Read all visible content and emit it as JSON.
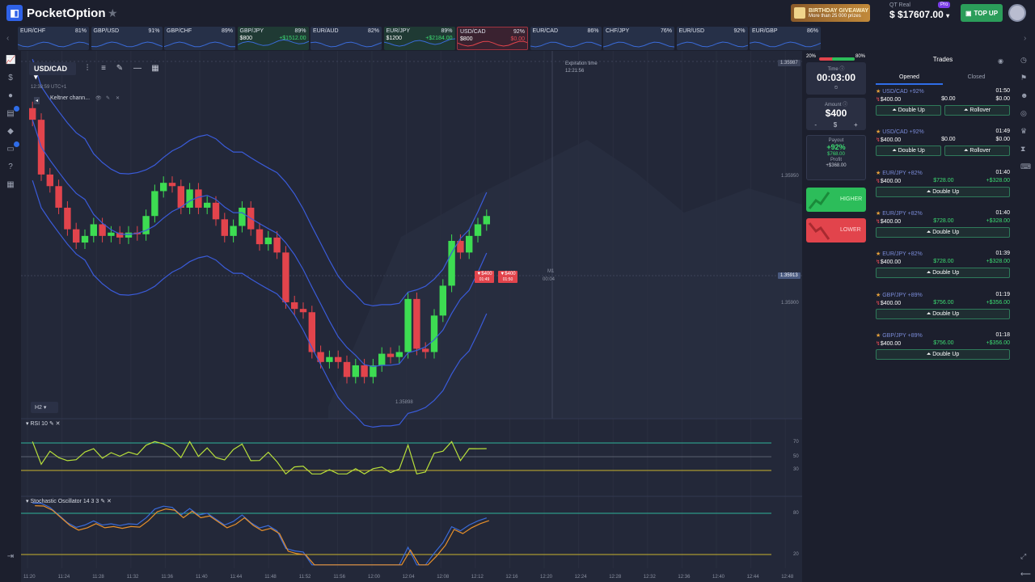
{
  "header": {
    "brand": "PocketOption",
    "promo_title": "BIRTHDAY GIVEAWAY",
    "promo_sub": "More than 25 000 prizes",
    "account_label": "QT Real",
    "balance": "$17607.00",
    "pro_badge": "Pro",
    "topup_label": "TOP UP"
  },
  "tickers": [
    {
      "name": "EUR/CHF",
      "pct": "81%",
      "amount": "",
      "profit": "",
      "state": "normal"
    },
    {
      "name": "GBP/USD",
      "pct": "91%",
      "amount": "",
      "profit": "",
      "state": "normal"
    },
    {
      "name": "GBP/CHF",
      "pct": "89%",
      "amount": "",
      "profit": "",
      "state": "normal"
    },
    {
      "name": "GBP/JPY",
      "pct": "89%",
      "amount": "$800",
      "profit": "+$1512.00",
      "state": "green"
    },
    {
      "name": "EUR/AUD",
      "pct": "82%",
      "amount": "",
      "profit": "",
      "state": "normal"
    },
    {
      "name": "EUR/JPY",
      "pct": "89%",
      "amount": "$1200",
      "profit": "+$2184.00",
      "state": "green"
    },
    {
      "name": "USD/CAD",
      "pct": "92%",
      "amount": "$800",
      "profit": "$0.00",
      "state": "red"
    },
    {
      "name": "EUR/CAD",
      "pct": "86%",
      "amount": "",
      "profit": "",
      "state": "normal"
    },
    {
      "name": "CHF/JPY",
      "pct": "76%",
      "amount": "",
      "profit": "",
      "state": "normal"
    },
    {
      "name": "EUR/USD",
      "pct": "92%",
      "amount": "",
      "profit": "",
      "state": "normal"
    },
    {
      "name": "EUR/GBP",
      "pct": "86%",
      "amount": "",
      "profit": "",
      "state": "normal"
    }
  ],
  "chart": {
    "asset": "USD/CAD",
    "time_label": "12:38:59 UTC+1",
    "indicator": "Keltner chann...",
    "expiration_label": "Expiration time",
    "expiration_time": "12:21:56",
    "timeframe": "H2",
    "price_top": "1.35987",
    "price_1": "1.35950",
    "price_current": "1.35913",
    "price_2": "1.35900",
    "price_low": "1.35898",
    "m1": "M1",
    "m1_sub": "00:04",
    "markers": [
      {
        "label": "▼$400",
        "sub": "01:49"
      },
      {
        "label": "▼$400",
        "sub": "01:50"
      }
    ],
    "rsi_label": "RSI 10",
    "rsi_levels": [
      "70",
      "50",
      "30"
    ],
    "stoch_label": "Stochastic Oscillator 14 3 3",
    "stoch_levels": [
      "80",
      "20"
    ],
    "x_labels": [
      "11:20",
      "11:24",
      "11:28",
      "11:32",
      "11:36",
      "11:40",
      "11:44",
      "11:48",
      "11:52",
      "11:56",
      "12:00",
      "12:04",
      "12:08",
      "12:12",
      "12:16",
      "12:20",
      "12:24",
      "12:28",
      "12:32",
      "12:36",
      "12:40",
      "12:44",
      "12:48"
    ]
  },
  "order": {
    "bar_left": "20%",
    "bar_right": "80%",
    "time_caption": "Time",
    "time_value": "00:03:00",
    "amount_caption": "Amount",
    "amount_value": "$400",
    "minus": "-",
    "currency": "$",
    "plus": "+",
    "payout_caption": "Payout",
    "payout_pct": "+92%",
    "payout_value": "$768.00",
    "profit_caption": "Profit",
    "profit_value": "+$368.00",
    "higher_label": "HIGHER",
    "lower_label": "LOWER"
  },
  "trades_panel": {
    "title": "Trades",
    "tabs": [
      "Opened",
      "Closed"
    ],
    "items": [
      {
        "pair": "USD/CAD +92%",
        "time": "01:50",
        "amount": "$400.00",
        "mid": "$0.00",
        "result": "$0.00",
        "buttons": [
          "Double Up",
          "Rollover"
        ]
      },
      {
        "pair": "USD/CAD +92%",
        "time": "01:49",
        "amount": "$400.00",
        "mid": "$0.00",
        "result": "$0.00",
        "buttons": [
          "Double Up",
          "Rollover"
        ]
      },
      {
        "pair": "EUR/JPY +82%",
        "time": "01:40",
        "amount": "$400.00",
        "mid": "$728.00",
        "result": "+$328.00",
        "buttons": [
          "Double Up"
        ]
      },
      {
        "pair": "EUR/JPY +82%",
        "time": "01:40",
        "amount": "$400.00",
        "mid": "$728.00",
        "result": "+$328.00",
        "buttons": [
          "Double Up"
        ]
      },
      {
        "pair": "EUR/JPY +82%",
        "time": "01:39",
        "amount": "$400.00",
        "mid": "$728.00",
        "result": "+$328.00",
        "buttons": [
          "Double Up"
        ]
      },
      {
        "pair": "GBP/JPY +89%",
        "time": "01:19",
        "amount": "$400.00",
        "mid": "$756.00",
        "result": "+$356.00",
        "buttons": [
          "Double Up"
        ]
      },
      {
        "pair": "GBP/JPY +89%",
        "time": "01:18",
        "amount": "$400.00",
        "mid": "$756.00",
        "result": "+$356.00",
        "buttons": [
          "Double Up"
        ]
      }
    ]
  },
  "colors": {
    "up": "#3ddc52",
    "down": "#e2444c",
    "keltner": "#3a5bd9",
    "rsi": "#b8e03a",
    "stoch_k": "#3a6bd9",
    "stoch_d": "#e8902a",
    "level": "#2fb39a"
  },
  "candles": [
    {
      "o": 1.35975,
      "c": 1.35968
    },
    {
      "o": 1.35968,
      "c": 1.35935
    },
    {
      "o": 1.35935,
      "c": 1.35928
    },
    {
      "o": 1.35928,
      "c": 1.35915
    },
    {
      "o": 1.35915,
      "c": 1.35902
    },
    {
      "o": 1.35902,
      "c": 1.35894
    },
    {
      "o": 1.35894,
      "c": 1.35898
    },
    {
      "o": 1.35898,
      "c": 1.35905
    },
    {
      "o": 1.35905,
      "c": 1.35898
    },
    {
      "o": 1.35898,
      "c": 1.359
    },
    {
      "o": 1.359,
      "c": 1.35897
    },
    {
      "o": 1.35897,
      "c": 1.359
    },
    {
      "o": 1.359,
      "c": 1.35899
    },
    {
      "o": 1.35899,
      "c": 1.3591
    },
    {
      "o": 1.3591,
      "c": 1.35925
    },
    {
      "o": 1.35925,
      "c": 1.3593
    },
    {
      "o": 1.3593,
      "c": 1.35928
    },
    {
      "o": 1.35928,
      "c": 1.35915
    },
    {
      "o": 1.35915,
      "c": 1.35926
    },
    {
      "o": 1.35926,
      "c": 1.35915
    },
    {
      "o": 1.35915,
      "c": 1.35918
    },
    {
      "o": 1.35918,
      "c": 1.35908
    },
    {
      "o": 1.35908,
      "c": 1.35898
    },
    {
      "o": 1.35898,
      "c": 1.35904
    },
    {
      "o": 1.35904,
      "c": 1.35915
    },
    {
      "o": 1.35915,
      "c": 1.35902
    },
    {
      "o": 1.35902,
      "c": 1.35893
    },
    {
      "o": 1.35893,
      "c": 1.35897
    },
    {
      "o": 1.35897,
      "c": 1.35888
    },
    {
      "o": 1.35888,
      "c": 1.35858
    },
    {
      "o": 1.35858,
      "c": 1.35854
    },
    {
      "o": 1.35854,
      "c": 1.35852
    },
    {
      "o": 1.35852,
      "c": 1.35828
    },
    {
      "o": 1.35828,
      "c": 1.35822
    },
    {
      "o": 1.35822,
      "c": 1.35825
    },
    {
      "o": 1.35825,
      "c": 1.35822
    },
    {
      "o": 1.35822,
      "c": 1.35813
    },
    {
      "o": 1.35813,
      "c": 1.3582
    },
    {
      "o": 1.3582,
      "c": 1.35813
    },
    {
      "o": 1.35813,
      "c": 1.3582
    },
    {
      "o": 1.3582,
      "c": 1.35827
    },
    {
      "o": 1.35827,
      "c": 1.35825
    },
    {
      "o": 1.35825,
      "c": 1.35828
    },
    {
      "o": 1.35828,
      "c": 1.3586
    },
    {
      "o": 1.3586,
      "c": 1.3583
    },
    {
      "o": 1.3583,
      "c": 1.35828
    },
    {
      "o": 1.35828,
      "c": 1.3585
    },
    {
      "o": 1.3585,
      "c": 1.35868
    },
    {
      "o": 1.35868,
      "c": 1.35895
    },
    {
      "o": 1.35895,
      "c": 1.35888
    },
    {
      "o": 1.35888,
      "c": 1.35898
    },
    {
      "o": 1.35898,
      "c": 1.35905
    },
    {
      "o": 1.35905,
      "c": 1.3591
    }
  ]
}
